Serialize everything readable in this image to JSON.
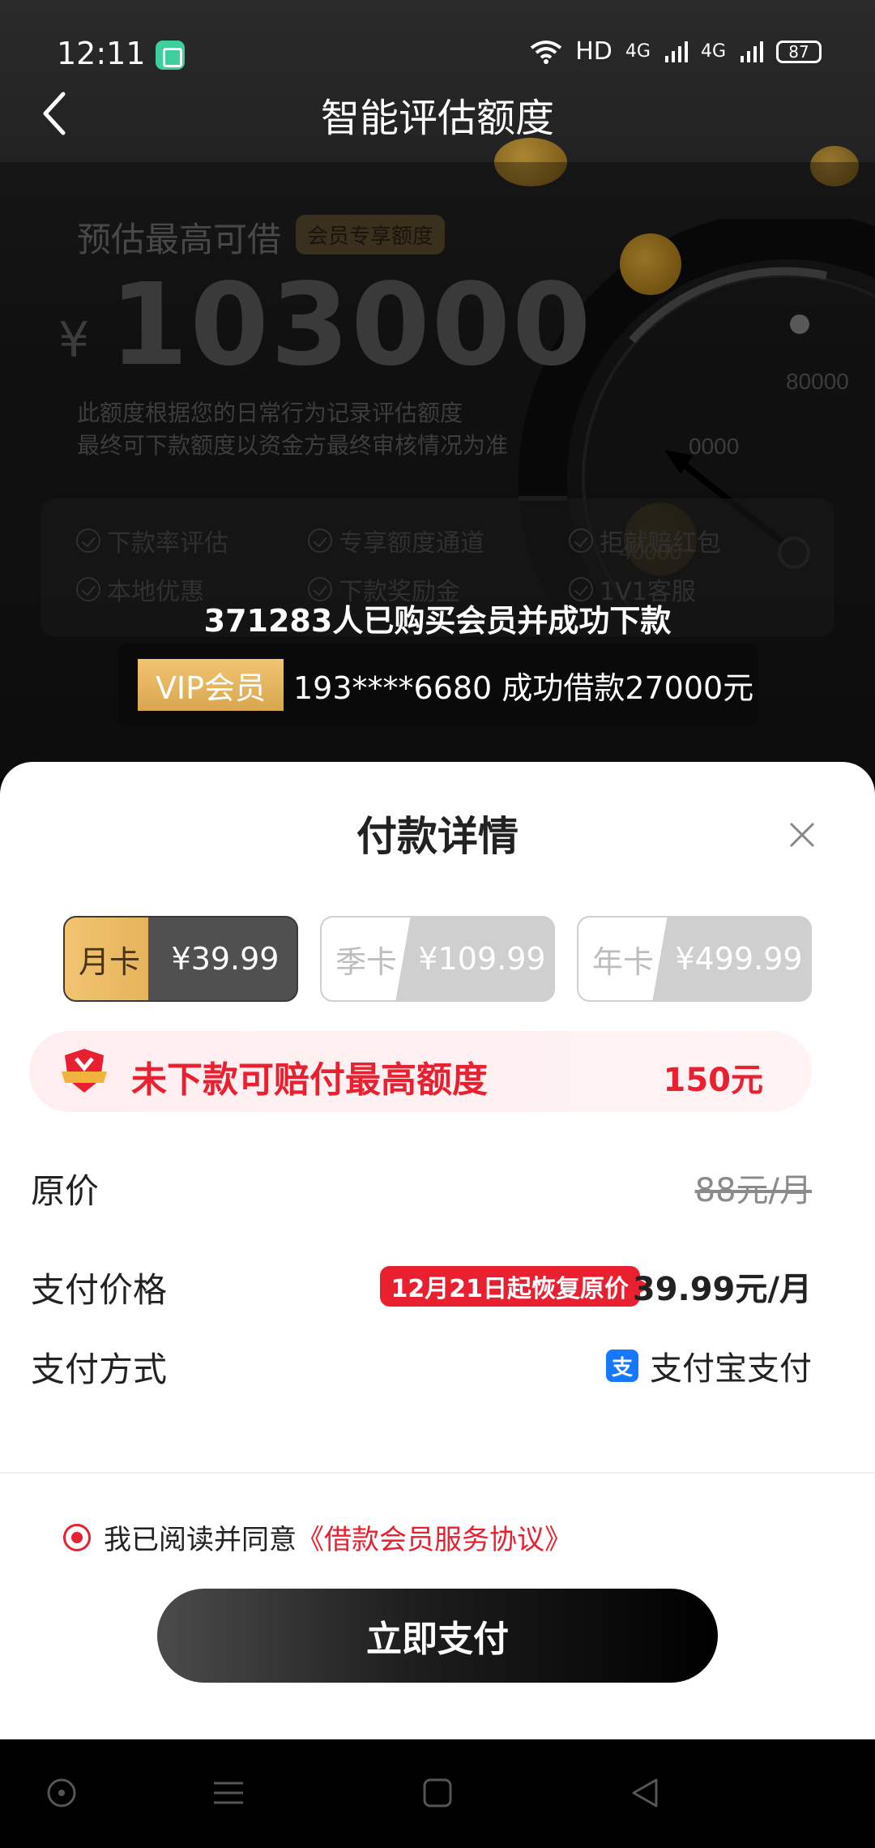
{
  "status_bar": {
    "time": "12:11",
    "network": "HD",
    "signal1": "4G",
    "signal2": "4G",
    "battery": "87"
  },
  "nav": {
    "title": "智能评估额度"
  },
  "hero": {
    "estimate_label": "预估最高可借",
    "member_tag": "会员专享额度",
    "currency": "¥",
    "amount": "103000",
    "desc_line1": "此额度根据您的日常行为记录评估额度",
    "desc_line2": "最终可下款额度以资金方最终审核情况为准",
    "gauge_labels": [
      "80000",
      "0000",
      "40000"
    ],
    "features": [
      "下款率评估",
      "专享额度通道",
      "拒就赔红包",
      "本地优惠",
      "下款奖励金",
      "1V1客服"
    ],
    "buyers_text": "371283人已购买会员并成功下款",
    "ticker_tag": "VIP会员",
    "ticker_text": "193****6680 成功借款27000元"
  },
  "sheet": {
    "title": "付款详情",
    "plans": [
      {
        "name": "月卡",
        "price": "¥39.99",
        "selected": true
      },
      {
        "name": "季卡",
        "price": "¥109.99",
        "selected": false
      },
      {
        "name": "年卡",
        "price": "¥499.99",
        "selected": false
      }
    ],
    "compensation_text": "未下款可赔付最高额度",
    "compensation_amount": "150元",
    "original_price_label": "原价",
    "original_price_value": "88元/月",
    "pay_price_label": "支付价格",
    "pay_price_tag": "12月21日起恢复原价",
    "pay_price_value": "39.99元/月",
    "pay_method_label": "支付方式",
    "pay_method_value": "支付宝支付",
    "agree_text": "我已阅读并同意",
    "agree_link": "《借款会员服务协议》",
    "pay_button": "立即支付"
  },
  "colors": {
    "accent_red": "#e8202f",
    "gold": "#f2c470",
    "alipay_blue": "#1677ff"
  }
}
